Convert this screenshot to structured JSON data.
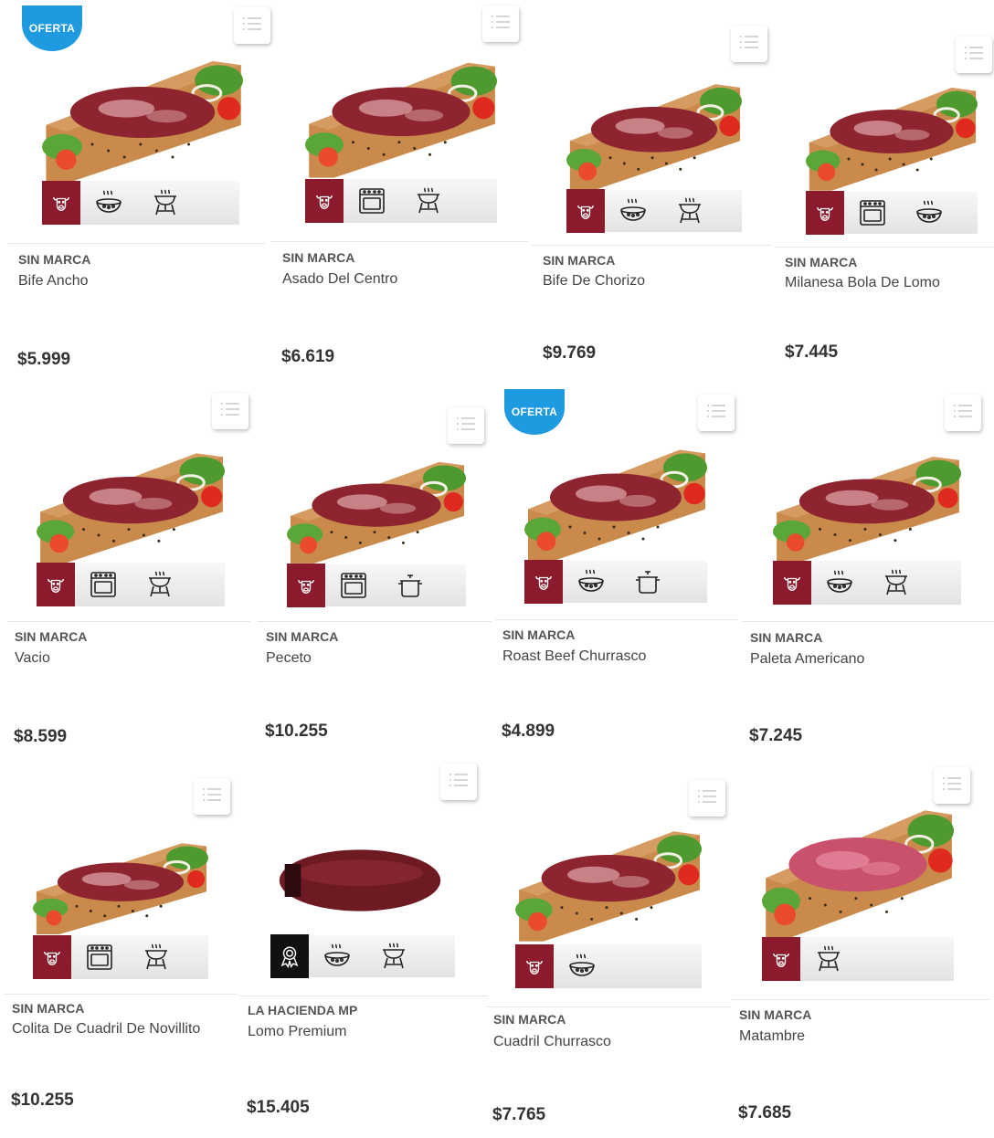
{
  "badge_text": "OFERTA",
  "colors": {
    "offer": "#1e9be0",
    "beef": "#8a1a2c",
    "award": "#111111"
  },
  "products": [
    {
      "brand": "SIN MARCA",
      "name": "Bife Ancho",
      "price": "$5.999",
      "offer": true,
      "category_icon": "cow-icon",
      "cook_icons": [
        "fry-pan-icon",
        "grill-icon"
      ]
    },
    {
      "brand": "SIN MARCA",
      "name": "Asado Del Centro",
      "price": "$6.619",
      "offer": false,
      "category_icon": "cow-icon",
      "cook_icons": [
        "oven-icon",
        "grill-icon"
      ]
    },
    {
      "brand": "SIN MARCA",
      "name": "Bife De Chorizo",
      "price": "$9.769",
      "offer": false,
      "category_icon": "cow-icon",
      "cook_icons": [
        "fry-pan-icon",
        "grill-icon"
      ]
    },
    {
      "brand": "SIN MARCA",
      "name": "Milanesa Bola De Lomo",
      "price": "$7.445",
      "offer": false,
      "category_icon": "cow-icon",
      "cook_icons": [
        "oven-icon",
        "fry-pan-icon"
      ]
    },
    {
      "brand": "SIN MARCA",
      "name": "Vacio",
      "price": "$8.599",
      "offer": false,
      "category_icon": "cow-icon",
      "cook_icons": [
        "oven-icon",
        "grill-icon"
      ]
    },
    {
      "brand": "SIN MARCA",
      "name": "Peceto",
      "price": "$10.255",
      "offer": false,
      "category_icon": "cow-icon",
      "cook_icons": [
        "oven-icon",
        "pot-icon"
      ]
    },
    {
      "brand": "SIN MARCA",
      "name": "Roast Beef Churrasco",
      "price": "$4.899",
      "offer": true,
      "category_icon": "cow-icon",
      "cook_icons": [
        "fry-pan-icon",
        "pot-icon"
      ]
    },
    {
      "brand": "SIN MARCA",
      "name": "Paleta Americano",
      "price": "$7.245",
      "offer": false,
      "category_icon": "cow-icon",
      "cook_icons": [
        "fry-pan-icon",
        "grill-icon"
      ]
    },
    {
      "brand": "SIN MARCA",
      "name": "Colita De Cuadril De Novillito",
      "price": "$10.255",
      "offer": false,
      "category_icon": "cow-icon",
      "cook_icons": [
        "oven-icon",
        "grill-icon"
      ]
    },
    {
      "brand": "LA HACIENDA MP",
      "name": "Lomo Premium",
      "price": "$15.405",
      "offer": false,
      "category_icon": "award-icon",
      "cook_icons": [
        "fry-pan-icon",
        "grill-icon"
      ]
    },
    {
      "brand": "SIN MARCA",
      "name": "Cuadril Churrasco",
      "price": "$7.765",
      "offer": false,
      "category_icon": "cow-icon",
      "cook_icons": [
        "fry-pan-icon"
      ]
    },
    {
      "brand": "SIN MARCA",
      "name": "Matambre",
      "price": "$7.685",
      "offer": false,
      "category_icon": "cow-icon",
      "cook_icons": [
        "grill-icon"
      ]
    }
  ]
}
